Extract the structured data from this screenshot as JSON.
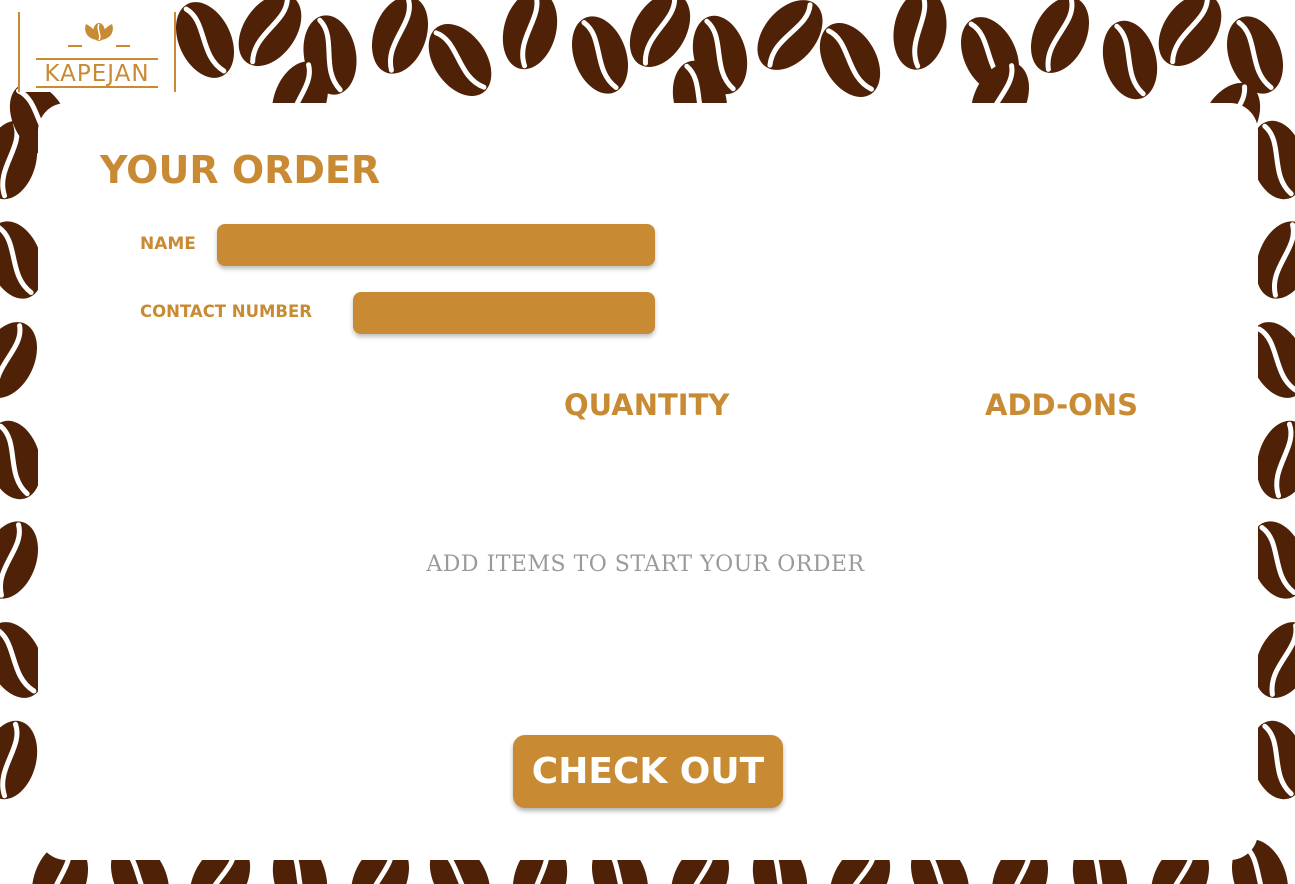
{
  "brand": {
    "logo_text": "KAPEJAN"
  },
  "order": {
    "title": "YOUR ORDER",
    "name_label": "NAME",
    "name_value": "",
    "contact_label": "CONTACT NUMBER",
    "contact_value": "",
    "columns": {
      "quantity": "QUANTITY",
      "addons": "ADD-ONS"
    },
    "empty_message": "ADD ITEMS TO START YOUR ORDER",
    "checkout_label": "CHECK OUT"
  },
  "colors": {
    "accent": "#c98a34",
    "bean": "#4f2207",
    "card": "#ffffff",
    "muted_text": "#9a9a9a"
  },
  "icons": {
    "logo": "coffee-bean-leaf-icon",
    "background": "coffee-bean-pattern"
  }
}
